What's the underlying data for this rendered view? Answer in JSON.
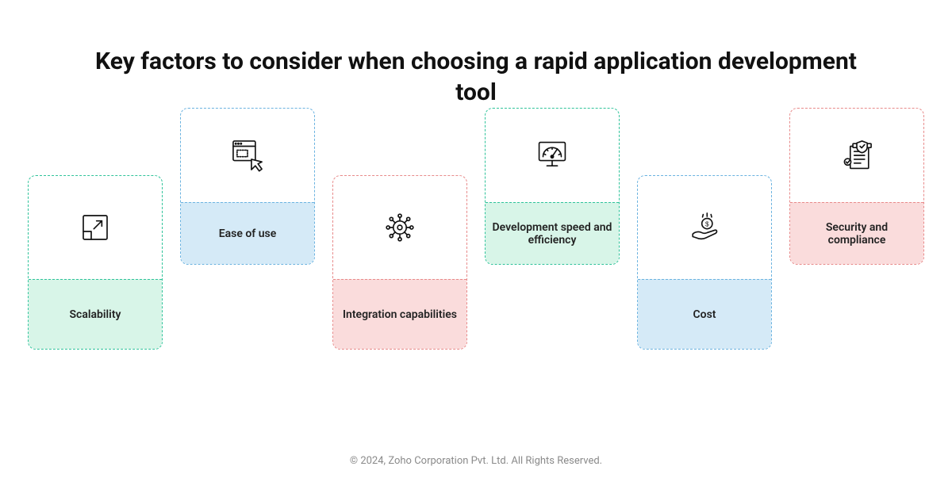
{
  "title": "Key factors to consider when choosing a rapid application development tool",
  "cards": [
    {
      "label": "Scalability",
      "icon": "scale-icon",
      "theme": "green",
      "pos": "lower"
    },
    {
      "label": "Ease of use",
      "icon": "cursor-icon",
      "theme": "blue",
      "pos": "upper"
    },
    {
      "label": "Integration capabilities",
      "icon": "gear-icon",
      "theme": "pink",
      "pos": "lower"
    },
    {
      "label": "Development speed and efficiency",
      "icon": "speed-icon",
      "theme": "green",
      "pos": "upper"
    },
    {
      "label": "Cost",
      "icon": "cost-icon",
      "theme": "blue",
      "pos": "lower"
    },
    {
      "label": "Security and compliance",
      "icon": "shield-icon",
      "theme": "pink",
      "pos": "upper"
    }
  ],
  "footer": "© 2024, Zoho Corporation Pvt. Ltd. All Rights Reserved."
}
